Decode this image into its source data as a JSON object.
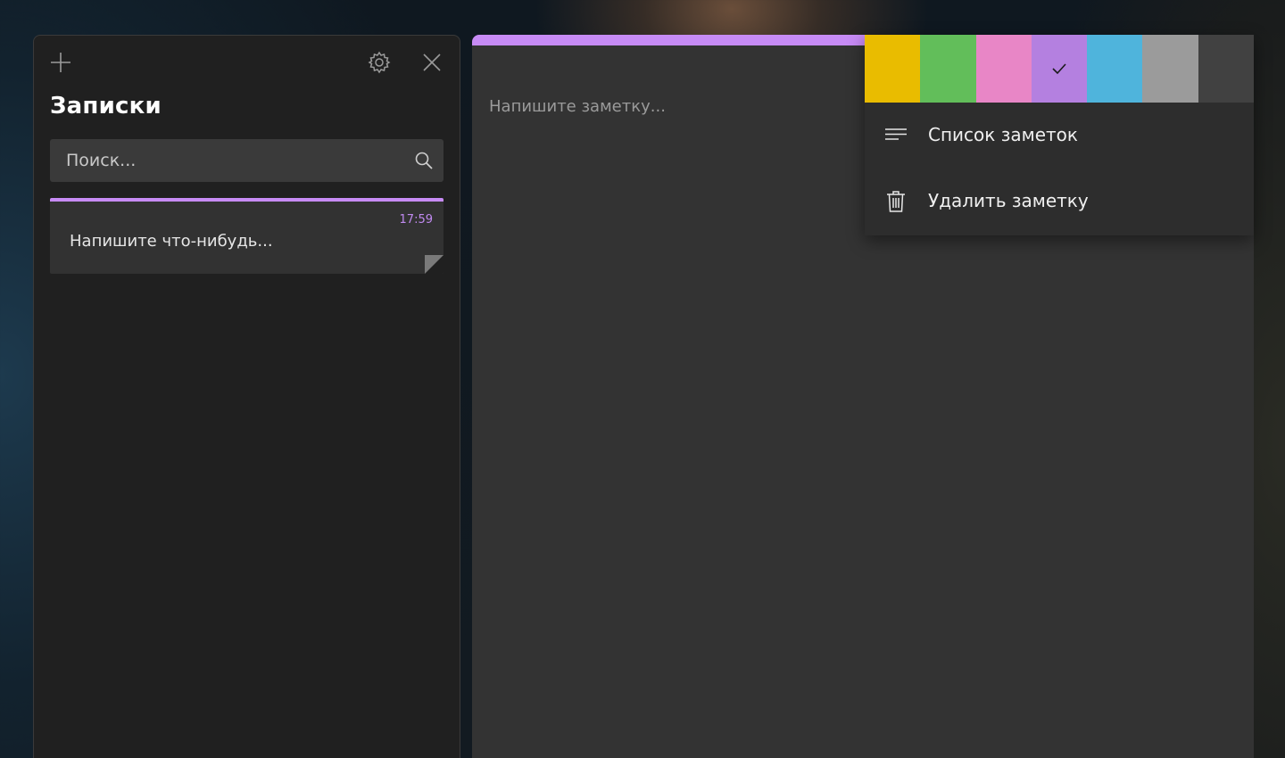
{
  "sidebar": {
    "title": "Записки",
    "add_icon": "plus-icon",
    "settings_icon": "gear-icon",
    "close_icon": "close-icon",
    "search": {
      "placeholder": "Поиск...",
      "icon": "search-icon"
    },
    "notes": [
      {
        "time": "17:59",
        "preview": "Напишите что-нибудь..."
      }
    ]
  },
  "editor": {
    "placeholder": "Напишите заметку..."
  },
  "menu": {
    "colors": [
      {
        "name": "yellow",
        "hex": "#E9BC00"
      },
      {
        "name": "green",
        "hex": "#62BE5A"
      },
      {
        "name": "pink",
        "hex": "#E886C6"
      },
      {
        "name": "purple",
        "hex": "#B480E0",
        "selected": true
      },
      {
        "name": "blue",
        "hex": "#4FB4DC"
      },
      {
        "name": "gray",
        "hex": "#9B9B9B"
      },
      {
        "name": "charcoal",
        "hex": "#414141"
      }
    ],
    "items": [
      {
        "label": "Список заметок",
        "icon": "list-icon"
      },
      {
        "label": "Удалить заметку",
        "icon": "trash-icon"
      }
    ]
  },
  "colors": {
    "accent": "#C78BF5",
    "time": "#C08AF0"
  }
}
